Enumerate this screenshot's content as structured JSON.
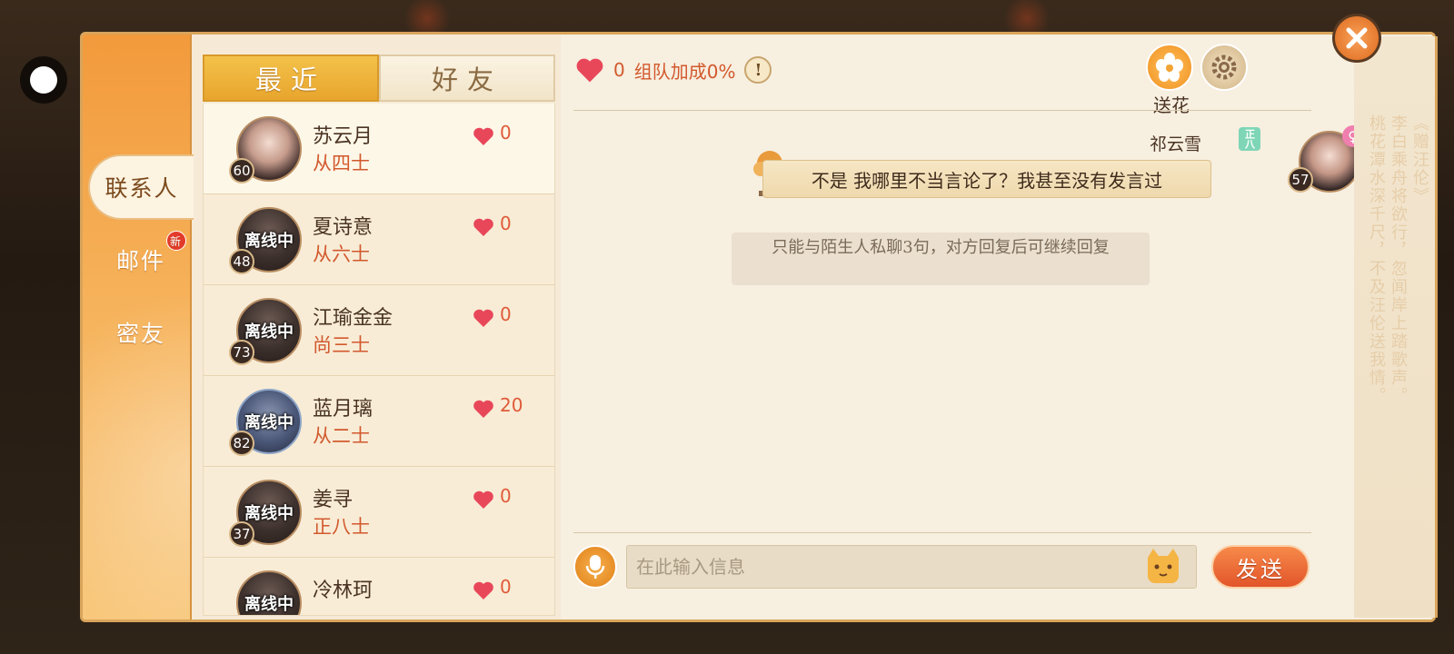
{
  "sidebar": {
    "tabs": [
      {
        "label": "联系人",
        "active": true
      },
      {
        "label": "邮件",
        "badge": "新"
      },
      {
        "label": "密友"
      }
    ]
  },
  "list_tabs": [
    {
      "label": "最近",
      "active": true
    },
    {
      "label": "好友",
      "active": false
    }
  ],
  "contacts": [
    {
      "name": "苏云月",
      "rank": "从四士",
      "level": "60",
      "hearts": "0",
      "status": "",
      "selected": true
    },
    {
      "name": "夏诗意",
      "rank": "从六士",
      "level": "48",
      "hearts": "0",
      "status": "离线中"
    },
    {
      "name": "江瑜金金",
      "rank": "尚三士",
      "level": "73",
      "hearts": "0",
      "status": "离线中"
    },
    {
      "name": "蓝月璃",
      "rank": "从二士",
      "level": "82",
      "hearts": "20",
      "status": "离线中"
    },
    {
      "name": "姜寻",
      "rank": "正八士",
      "level": "37",
      "hearts": "0",
      "status": "离线中"
    },
    {
      "name": "冷林珂",
      "rank": "",
      "level": "",
      "hearts": "0",
      "status": "离线中"
    }
  ],
  "chat": {
    "hearts": "0",
    "team_bonus": "组队加成0%",
    "flower_label": "送花",
    "message": {
      "sender": "祁云雪",
      "rank_tag": "正八",
      "level": "57",
      "gender": "♀",
      "text": "不是 我哪里不当言论了？我甚至没有发言过"
    },
    "system_note": "只能与陌生人私聊3句，对方回复后可继续回复",
    "input_placeholder": "在此输入信息",
    "send_label": "发送"
  },
  "poem_cols": [
    "《赠汪伦》",
    "李白乘舟将欲行，忽闻岸上踏歌声。",
    "桃花潭水深千尺，不及汪伦送我情。"
  ],
  "colors": {
    "accent": "#f29a3c",
    "heart": "#e8475a",
    "rank_text": "#d2592d"
  }
}
